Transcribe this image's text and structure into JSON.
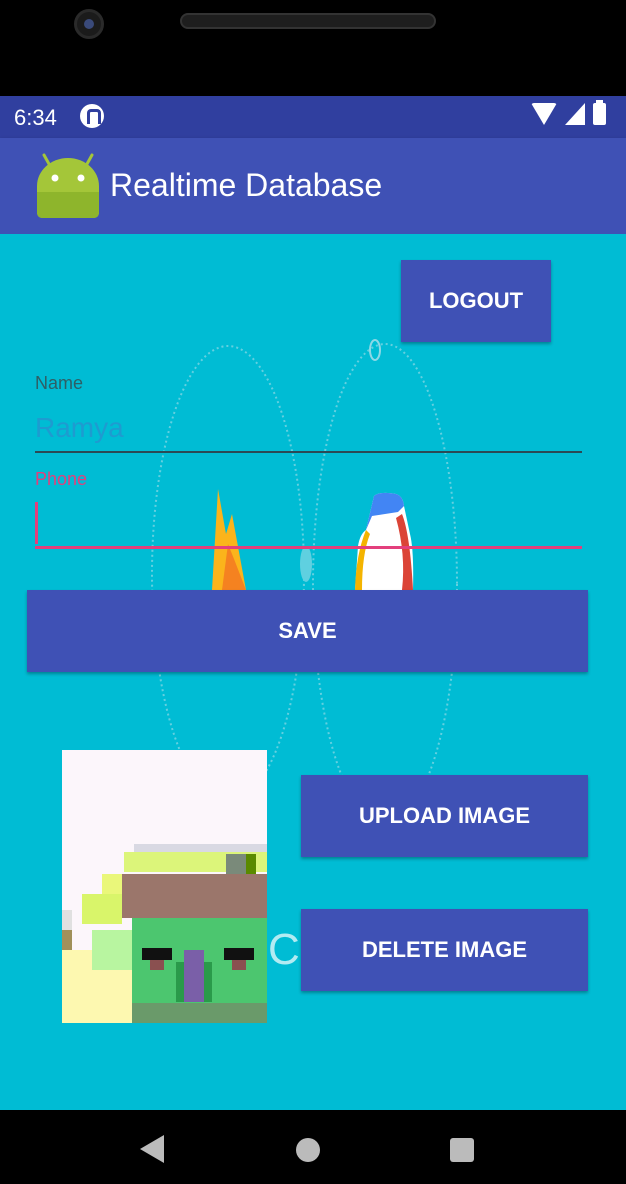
{
  "status_bar": {
    "time": "6:34"
  },
  "app_bar": {
    "title": "Realtime Database"
  },
  "form": {
    "logout_label": "LOGOUT",
    "name_label": "Name",
    "name_value": "Ramya",
    "phone_label": "Phone",
    "phone_value": "",
    "save_label": "SAVE",
    "upload_label": "UPLOAD IMAGE",
    "delete_label": "DELETE IMAGE"
  },
  "background": {
    "partial_text": "Clo"
  },
  "colors": {
    "status_bar": "#303f9f",
    "app_bar": "#3f51b5",
    "content_bg": "#00bcd4",
    "button": "#3f51b5",
    "accent": "#e33f7c"
  },
  "icons": [
    "android-launcher-icon",
    "wifi-icon",
    "signal-icon",
    "battery-icon",
    "notification-icon",
    "back-icon",
    "home-icon",
    "recents-icon"
  ]
}
